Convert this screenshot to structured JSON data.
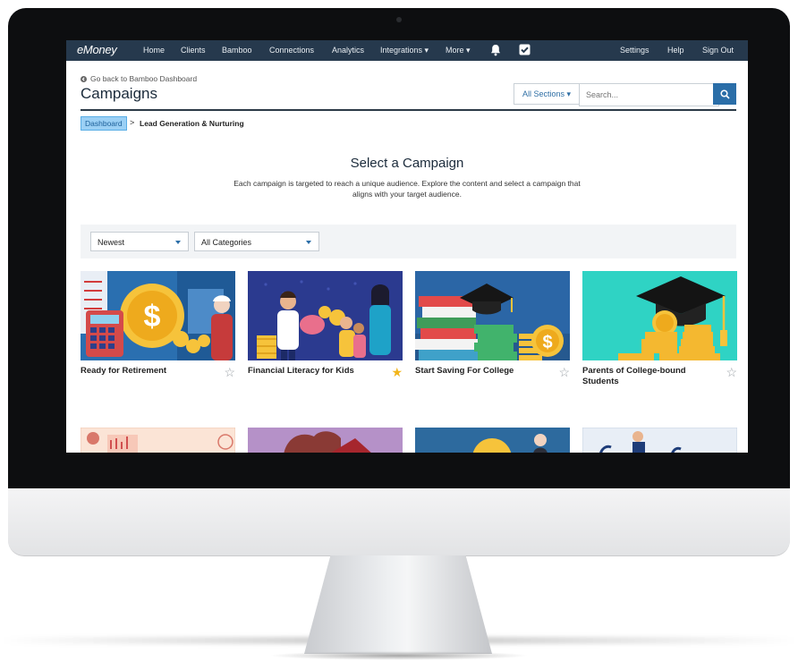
{
  "navbar": {
    "logo": "eMoney",
    "items": [
      "Home",
      "Clients",
      "Bamboo",
      "Connections",
      "Analytics",
      "Integrations ▾",
      "More ▾"
    ],
    "right_items": [
      "Settings",
      "Help",
      "Sign Out"
    ]
  },
  "header": {
    "back_link": "Go back to Bamboo Dashboard",
    "title": "Campaigns"
  },
  "search": {
    "sections_label": "All Sections ▾",
    "placeholder": "Search..."
  },
  "breadcrumb": {
    "root": "Dashboard",
    "separator": ">",
    "current": "Lead Generation & Nurturing"
  },
  "main": {
    "heading": "Select a Campaign",
    "intro_line1": "Each campaign is targeted to reach a unique audience. Explore the content and select a campaign that",
    "intro_line2": "aligns with your target audience."
  },
  "filters": {
    "sort": "Newest",
    "category": "All Categories"
  },
  "campaigns": [
    {
      "title": "Ready for Retirement",
      "favorited": false
    },
    {
      "title": "Financial Literacy for Kids",
      "favorited": true
    },
    {
      "title": "Start Saving For College",
      "favorited": false
    },
    {
      "title": "Parents of College-bound Students",
      "favorited": false
    }
  ],
  "colors": {
    "navbar": "#26394d",
    "accent": "#2b6ea8",
    "star_filled": "#f2b51a",
    "star_empty": "#9aa0a6",
    "breadcrumb_active": "#9bd0f5"
  },
  "icons": {
    "star_empty": "☆",
    "star_filled": "★"
  }
}
